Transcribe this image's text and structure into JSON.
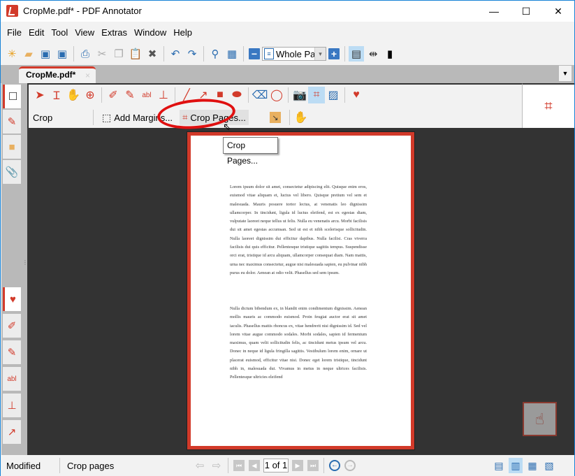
{
  "window": {
    "title": "CropMe.pdf* - PDF Annotator",
    "minimize": "—",
    "maximize": "☐",
    "close": "✕"
  },
  "menu": [
    "File",
    "Edit",
    "Tool",
    "View",
    "Extras",
    "Window",
    "Help"
  ],
  "toolbar": {
    "zoom_value": "Whole Page",
    "icons": [
      "new-document",
      "open-folder",
      "save",
      "save-as",
      "print",
      "cut",
      "copy",
      "paste",
      "delete",
      "undo",
      "redo",
      "find",
      "find-options",
      "zoom-out",
      "zoom-in",
      "fit-page",
      "fit-width",
      "full-screen"
    ]
  },
  "tabs": [
    {
      "label": "CropMe.pdf*",
      "close": "×"
    }
  ],
  "ribbon": {
    "tool_icons": [
      "select-arrow",
      "text-select",
      "hand",
      "zoom-tool",
      "pen",
      "highlighter",
      "textbox",
      "stamp",
      "line",
      "arrow",
      "rectangle",
      "ellipse",
      "eraser",
      "lasso",
      "camera",
      "crop",
      "insert-image",
      "favorites"
    ],
    "mode_label": "Crop",
    "add_margins_label": "Add Margins...",
    "crop_pages_label": "Crop Pages...",
    "active_tool": "crop"
  },
  "tooltip": "Crop Pages...",
  "document": {
    "paragraphs": [
      "Lorem ipsum dolor sit amet, consectetur adipiscing elit. Quisque enim eros, euismod vitae aliquam et, luctus vel libero. Quisque pretium vel sem et malesuada. Mauris posuere tortor lectus, at venenatis leo dignissim ullamcorper. In tincidunt, ligula id luctus eleifend, est ex egestas diam, vulputate laoreet neque tellus ut felis. Nulla eu venenatis arcu. Morbi facilisis dui sit amet egestas accumsan. Sed ut est et nibh scelerisque sollicitudin. Nulla laoreet dignissim dui efficitur dapibus. Nulla facilisi. Cras viverra facilisis dui quis efficitur. Pellentesque tristique sagittis tempus. Suspendisse orci erat, tristique id arcu aliquam, ullamcorper consequat diam. Nam mattis, urna nec maximus consectetur, augue nisi malesuada sapien, eu pulvinar nibh purus eu dolor. Aenean at odio velit. Phasellus sed sem ipsum.",
      "Nulla dictum bibendum ex, in blandit enim condimentum dignissim. Aenean mollis mauris ac commodo euismod. Proin feugiat auctor erat sit amet iaculis. Phasellus mattis rhoncus ex, vitae hendrerit nisi dignissim id. Sed vel lorem vitae augue commodo sodales. Morbi sodales, sapien id fermentum maximus, quam velit sollicitudin felis, ac tincidunt metus ipsum vel arcu. Donec in neque id ligula fringilla sagittis. Vestibulum lorem enim, ornare ut placerat euismod, efficitur vitae nisi. Donec eget lorem tristique, tincidunt nibh in, malesuada dui. Vivamus in metus in neque ultrices facilisis. Pellentesque ultricies eleifend"
    ]
  },
  "status": {
    "state": "Modified",
    "hint": "Crop pages",
    "page_indicator": "1 of 1"
  },
  "colors": {
    "accent": "#d23a2a",
    "canvas": "#333333",
    "selected": "#bcdcf4",
    "annotation_ellipse": "#e01010"
  }
}
